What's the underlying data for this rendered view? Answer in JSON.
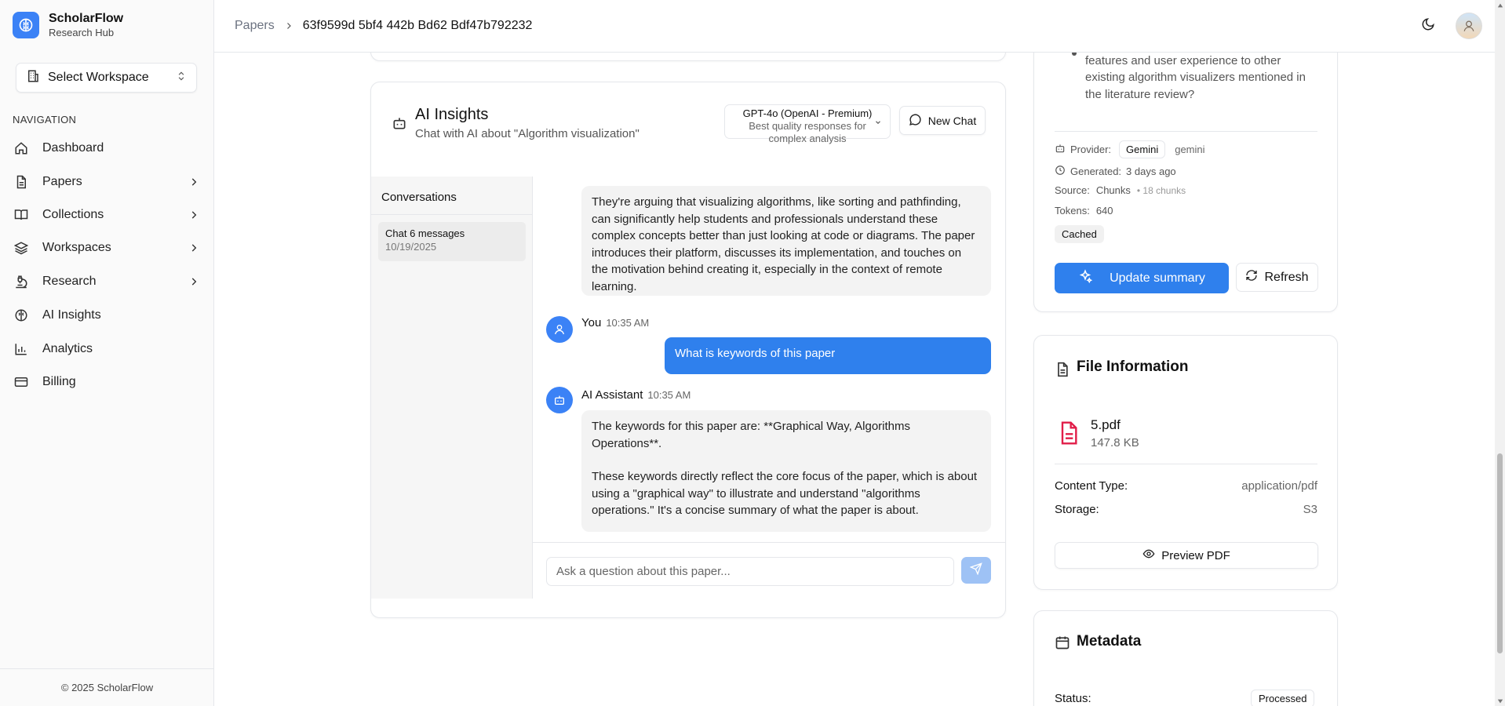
{
  "brand": {
    "name": "ScholarFlow",
    "subtitle": "Research Hub"
  },
  "workspace_select": {
    "label": "Select Workspace"
  },
  "nav": {
    "heading": "NAVIGATION",
    "items": [
      {
        "label": "Dashboard",
        "icon": "home-icon"
      },
      {
        "label": "Papers",
        "icon": "file-icon"
      },
      {
        "label": "Collections",
        "icon": "book-icon"
      },
      {
        "label": "Workspaces",
        "icon": "layers-icon"
      },
      {
        "label": "Research",
        "icon": "microscope-icon"
      },
      {
        "label": "AI Insights",
        "icon": "brain-icon"
      },
      {
        "label": "Analytics",
        "icon": "chart-icon"
      },
      {
        "label": "Billing",
        "icon": "card-icon"
      }
    ]
  },
  "footer": {
    "copyright": "© 2025 ScholarFlow"
  },
  "breadcrumb": {
    "parent": "Papers",
    "current": "63f9599d 5bf4 442b Bd62 Bdf47b792232"
  },
  "ai_insights": {
    "title": "AI Insights",
    "subtitle": "Chat with AI about \"Algorithm visualization\"",
    "model": {
      "name": "GPT-4o (OpenAI - Premium)",
      "description": "Best quality responses for complex analysis"
    },
    "new_chat": "New Chat",
    "conversations_title": "Conversations",
    "conversations": [
      {
        "title": "Chat 6 messages",
        "date": "10/19/2025"
      }
    ],
    "messages": [
      {
        "role": "assistant",
        "text": "They're arguing that visualizing algorithms, like sorting and pathfinding, can significantly help students and professionals understand these complex concepts better than just looking at code or diagrams. The paper introduces their platform, discusses its implementation, and touches on the motivation behind creating it, especially in the context of remote learning."
      },
      {
        "role": "user",
        "name": "You",
        "time": "10:35 AM",
        "text": "What is keywords of this paper"
      },
      {
        "role": "assistant",
        "name": "AI Assistant",
        "time": "10:35 AM",
        "p1": "The keywords for this paper are: **Graphical Way, Algorithms Operations**.",
        "p2": "These keywords directly reflect the core focus of the paper, which is about using a \"graphical way\" to illustrate and understand \"algorithms operations.\" It's a concise summary of what the paper is about."
      }
    ],
    "input_placeholder": "Ask a question about this paper..."
  },
  "summary": {
    "question": "How does AlgoViz compare in terms of features and user experience to other existing algorithm visualizers mentioned in the literature review?",
    "provider_label": "Provider:",
    "provider_badge": "Gemini",
    "provider_value": "gemini",
    "generated_label": "Generated:",
    "generated_value": "3 days ago",
    "source_label": "Source:",
    "source_value": "Chunks",
    "source_extra": "• 18 chunks",
    "tokens_label": "Tokens:",
    "tokens_value": "640",
    "cached": "Cached",
    "update_button": "Update summary",
    "refresh_button": "Refresh"
  },
  "file_info": {
    "title": "File Information",
    "file_name": "5.pdf",
    "file_size": "147.8 KB",
    "content_type_label": "Content Type:",
    "content_type_value": "application/pdf",
    "storage_label": "Storage:",
    "storage_value": "S3",
    "preview_button": "Preview PDF"
  },
  "metadata": {
    "title": "Metadata",
    "status_label": "Status:",
    "status_value": "Processed"
  },
  "colors": {
    "accent": "#2f80ed",
    "pdf_red": "#e11d48"
  }
}
